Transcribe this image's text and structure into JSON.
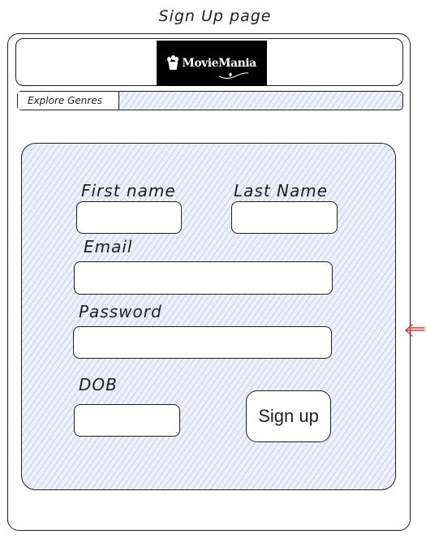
{
  "page_title": "Sign Up page",
  "header": {
    "logo_text": "MovieMania"
  },
  "nav": {
    "explore_genres": "Explore Genres"
  },
  "form": {
    "first_name_label": "First name",
    "last_name_label": "Last Name",
    "email_label": "Email",
    "password_label": "Password",
    "dob_label": "DOB",
    "signup_label": "Sign up"
  },
  "colors": {
    "hatch": "#7f8fd6",
    "stroke": "#1e1e1e",
    "annotation_arrow": "#e03131"
  },
  "icons": {
    "logo_mark": "popcorn-icon",
    "annotation": "arrow-left-icon"
  }
}
